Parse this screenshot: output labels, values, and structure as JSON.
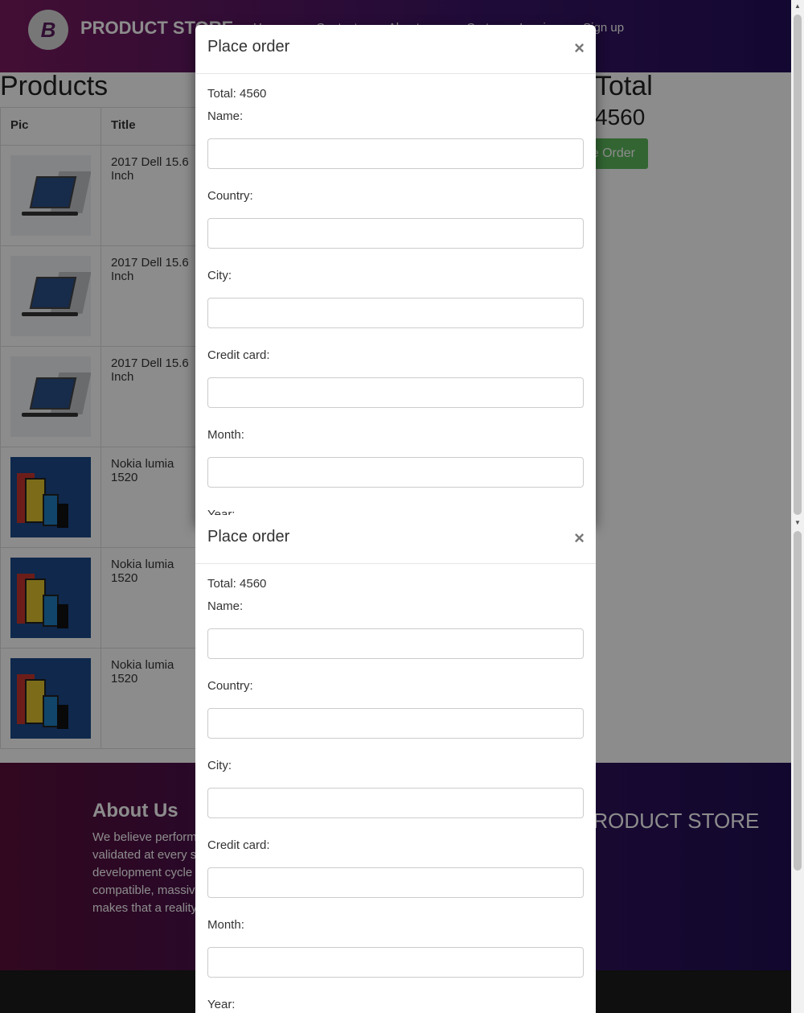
{
  "navbar": {
    "brand": "PRODUCT STORE",
    "logo_letter": "B",
    "links": [
      "Home",
      "Contact",
      "About us",
      "Cart",
      "Log in",
      "Sign up"
    ]
  },
  "cart": {
    "products_title": "Products",
    "total_title": "Total",
    "total_value": "4560",
    "place_order_label": "Place Order",
    "columns": [
      "Pic",
      "Title"
    ],
    "rows": [
      {
        "title": "2017 Dell 15.6 Inch",
        "image": "laptop"
      },
      {
        "title": "2017 Dell 15.6 Inch",
        "image": "laptop"
      },
      {
        "title": "2017 Dell 15.6 Inch",
        "image": "laptop"
      },
      {
        "title": "Nokia lumia 1520",
        "image": "phone"
      },
      {
        "title": "Nokia lumia 1520",
        "image": "phone"
      },
      {
        "title": "Nokia lumia 1520",
        "image": "phone"
      }
    ]
  },
  "footer": {
    "about_title": "About Us",
    "about_lines": [
      "We believe performance needs to be",
      "validated at every stage of the software",
      "development cycle and our open source",
      "compatible, massively scalable platform",
      "makes that a reality."
    ],
    "brand": "PRODUCT STORE"
  },
  "modal": {
    "title": "Place order",
    "close_symbol": "×",
    "total_text": "Total: 4560",
    "fields": {
      "name_label": "Name:",
      "country_label": "Country:",
      "city_label": "City:",
      "card_label": "Credit card:",
      "month_label": "Month:",
      "year_label": "Year:"
    }
  },
  "colors": {
    "primary_button": "#5cb85c",
    "navbar_gradient_start": "#7a1a5e",
    "navbar_gradient_end": "#24105c"
  }
}
